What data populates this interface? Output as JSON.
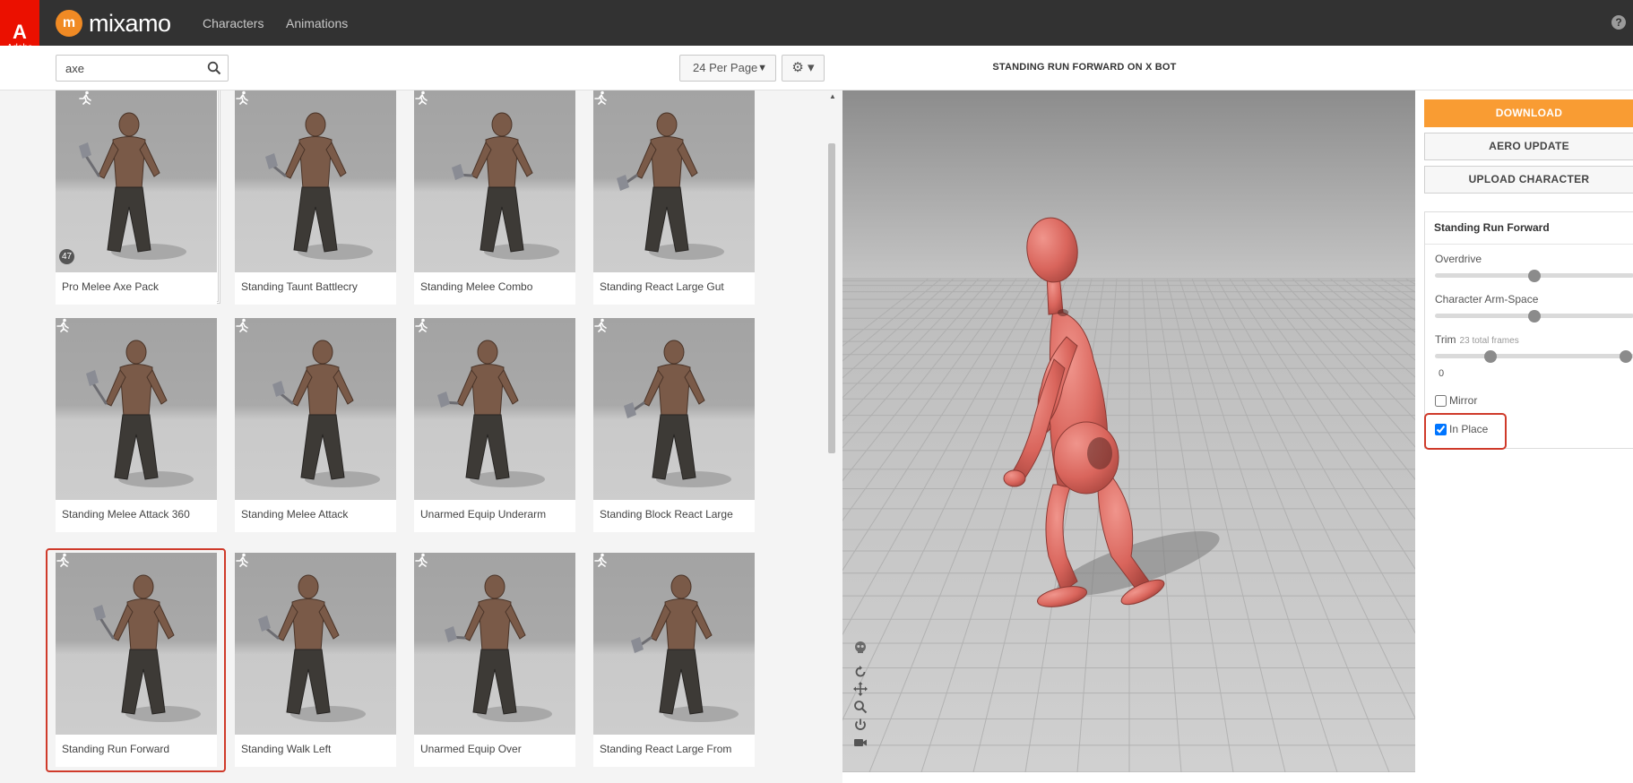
{
  "app": {
    "brand_mark": "A",
    "brand_word": "Adobe",
    "logo_glyph": "m",
    "name": "mixamo"
  },
  "nav": {
    "items": [
      "Characters",
      "Animations"
    ],
    "help": "?"
  },
  "toolbar": {
    "search_value": "axe",
    "per_page": "24 Per Page",
    "gear": "⚙ ▾"
  },
  "viewer": {
    "title": "STANDING RUN FORWARD ON X BOT"
  },
  "actions": {
    "download": "DOWNLOAD",
    "aero_update": "AERO UPDATE",
    "upload": "UPLOAD CHARACTER"
  },
  "settings": {
    "title": "Standing Run Forward",
    "overdrive": {
      "label": "Overdrive",
      "value": 0.5
    },
    "arm_space": {
      "label": "Character Arm-Space",
      "value": 0.5
    },
    "trim": {
      "label": "Trim",
      "hint": "23 total frames",
      "start_value": "0",
      "start": 0.28,
      "end": 1.0
    },
    "mirror": {
      "label": "Mirror",
      "checked": false
    },
    "in_place": {
      "label": "In Place",
      "checked": true
    }
  },
  "animations": [
    {
      "label": "Pro Melee Axe Pack",
      "pack_count": "47",
      "selected": false
    },
    {
      "label": "Standing Taunt Battlecry",
      "selected": false
    },
    {
      "label": "Standing Melee Combo",
      "selected": false
    },
    {
      "label": "Standing React Large Gut",
      "selected": false
    },
    {
      "label": "Standing Melee Attack 360",
      "selected": false
    },
    {
      "label": "Standing Melee Attack",
      "selected": false
    },
    {
      "label": "Unarmed Equip Underarm",
      "selected": false
    },
    {
      "label": "Standing Block React Large",
      "selected": false
    },
    {
      "label": "Standing Run Forward",
      "selected": true
    },
    {
      "label": "Standing Walk Left",
      "selected": false
    },
    {
      "label": "Unarmed Equip Over",
      "selected": false
    },
    {
      "label": "Standing React Large From",
      "selected": false
    }
  ],
  "colors": {
    "accent": "#f99c33",
    "adobe_red": "#eb1000",
    "selection": "#cf3a2a",
    "topbar": "#323232"
  },
  "icons": {
    "search": "search-icon",
    "gear": "gear-icon",
    "run": "run-icon",
    "help": "help-icon"
  }
}
